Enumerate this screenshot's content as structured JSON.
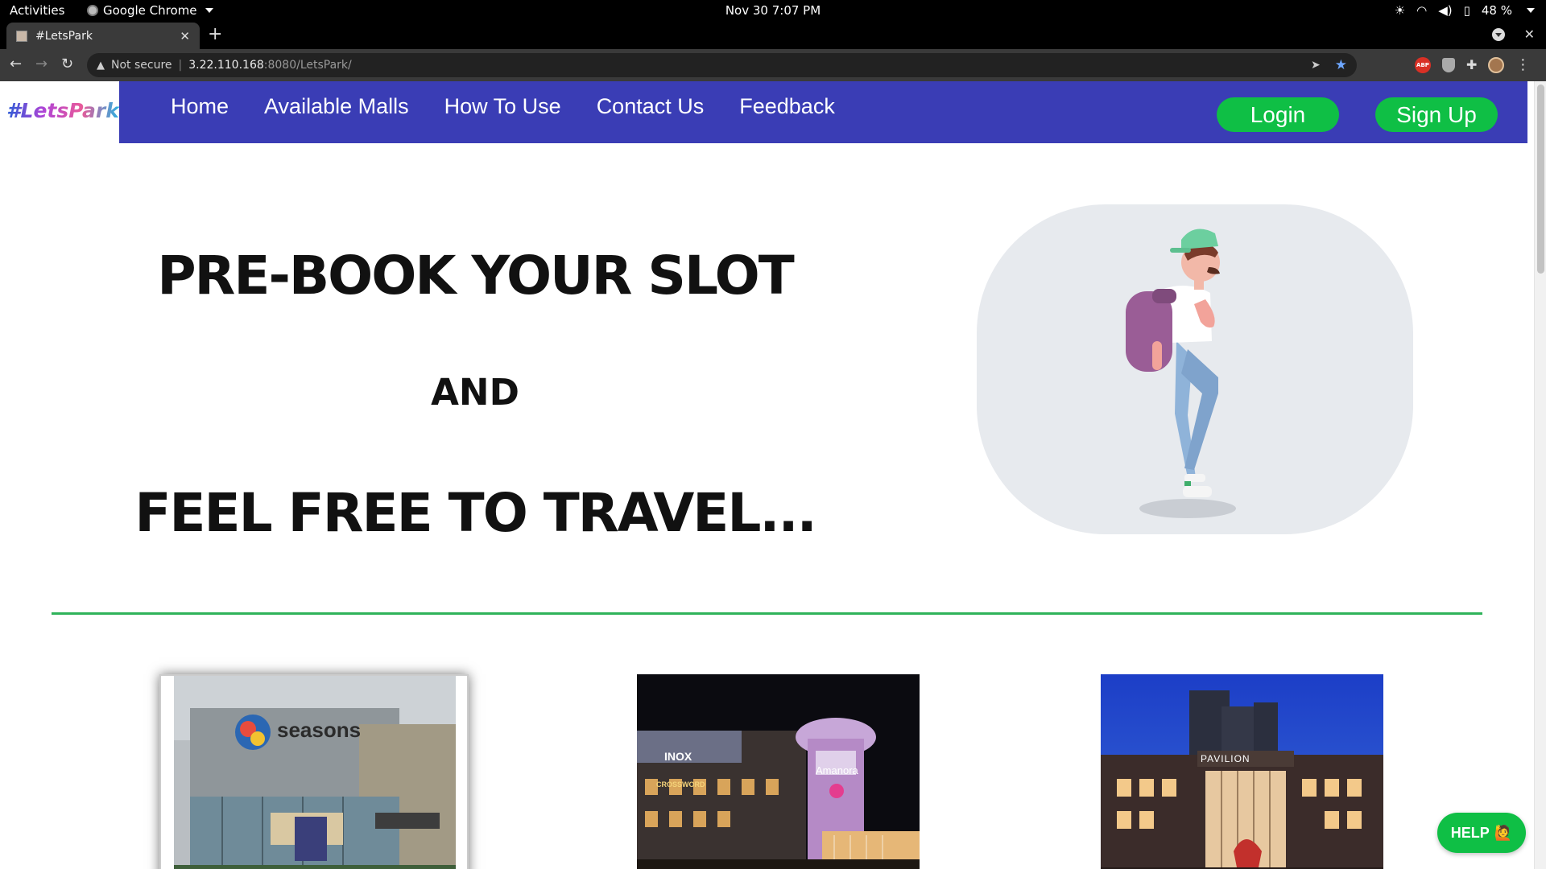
{
  "system_bar": {
    "activities": "Activities",
    "app_name": "Google Chrome",
    "clock": "Nov 30  7:07 PM",
    "battery": "48 %"
  },
  "browser": {
    "tab_title": "#LetsPark",
    "security_label": "Not secure",
    "url_host": "3.22.110.168",
    "url_rest": ":8080/LetsPark/"
  },
  "site": {
    "logo": "#LetsPark",
    "nav": [
      "Home",
      "Available Malls",
      "How To Use",
      "Contact Us",
      "Feedback"
    ],
    "login": "Login",
    "signup": "Sign Up",
    "hero": {
      "line1": "PRE-BOOK YOUR SLOT",
      "line2": "AND",
      "line3": "FEEL FREE TO TRAVEL..."
    },
    "malls": [
      {
        "sign": "seasons"
      },
      {
        "sign": "Amanora",
        "sign2": "INOX",
        "sign3": "CROSSWORD"
      },
      {
        "sign": "PAVILION"
      }
    ],
    "help": "HELP"
  },
  "colors": {
    "nav_bg": "#3a3db5",
    "accent_green": "#0fbf45",
    "divider": "#2fb35a"
  }
}
